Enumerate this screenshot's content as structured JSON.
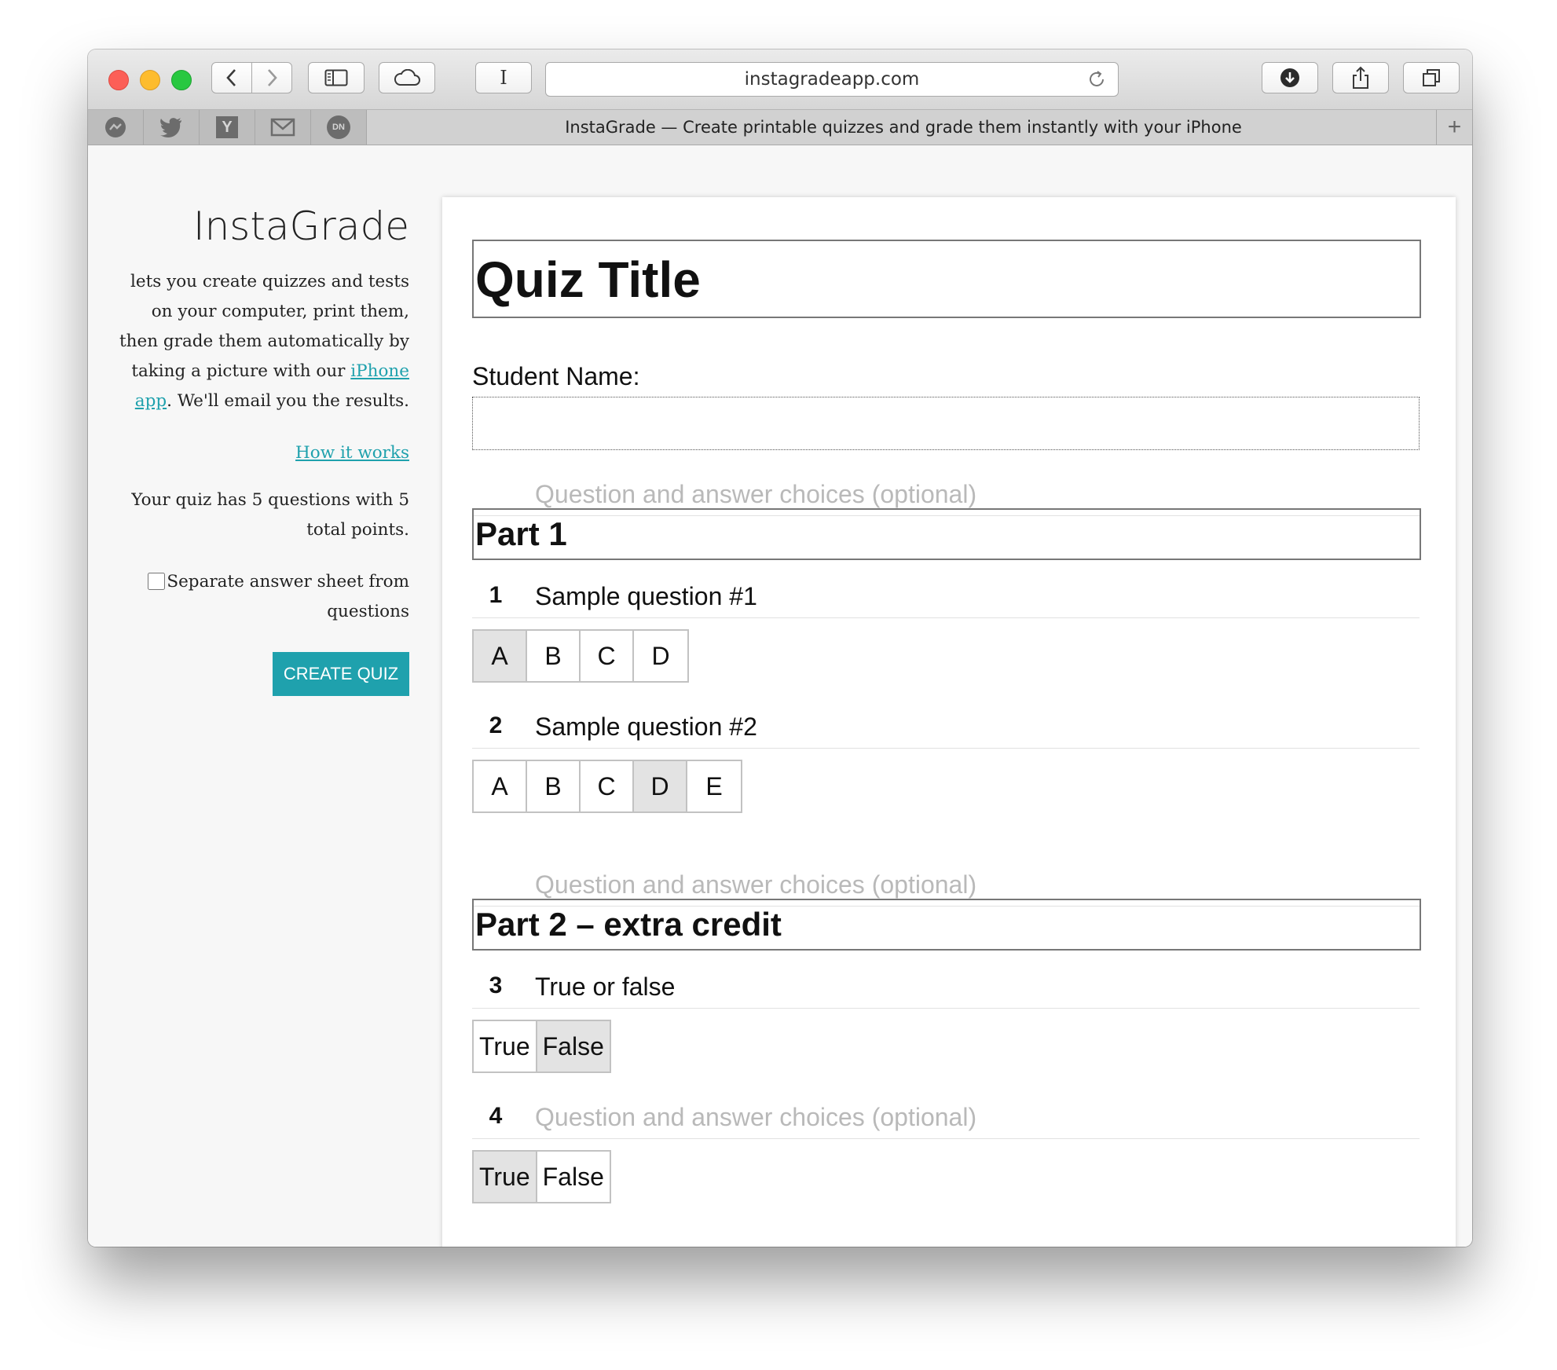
{
  "browser": {
    "url": "instagradeapp.com",
    "tab_title": "InstaGrade — Create printable quizzes and grade them instantly with your iPhone",
    "new_tab_symbol": "+",
    "favorites": [
      {
        "name": "messenger",
        "glyph": ""
      },
      {
        "name": "twitter",
        "glyph": ""
      },
      {
        "name": "hacker-news",
        "glyph": "Y"
      },
      {
        "name": "mail",
        "glyph": ""
      },
      {
        "name": "designer-news",
        "glyph": "DN"
      }
    ],
    "reader_button": "I"
  },
  "sidebar": {
    "brand": "InstaGrade",
    "desc_before": "lets you create quizzes and tests on your computer, print them, then grade them automatically by taking a picture with our ",
    "iphone_link": "iPhone app",
    "desc_after": ". We'll email you the results.",
    "how_it_works": "How it works",
    "summary": "Your quiz has 5 questions with 5 total points.",
    "separate_label": "Separate answer sheet from questions",
    "separate_checked": false,
    "create_button": "CREATE QUIZ",
    "accent_color": "#1fa1ad"
  },
  "quiz": {
    "title": "Quiz Title",
    "student_label": "Student Name:",
    "placeholder": "Question and answer choices (optional)",
    "parts": [
      "Part 1",
      "Part 2 – extra credit"
    ],
    "questions": [
      {
        "number": "1",
        "text": "Sample question #1",
        "choices": [
          "A",
          "B",
          "C",
          "D"
        ],
        "selected": "A"
      },
      {
        "number": "2",
        "text": "Sample question #2",
        "choices": [
          "A",
          "B",
          "C",
          "D",
          "E"
        ],
        "selected": "D"
      },
      {
        "number": "3",
        "text": "True or false",
        "choices": [
          "True",
          "False"
        ],
        "selected": "False"
      },
      {
        "number": "4",
        "text": "",
        "choices": [
          "True",
          "False"
        ],
        "selected": "True"
      }
    ]
  }
}
